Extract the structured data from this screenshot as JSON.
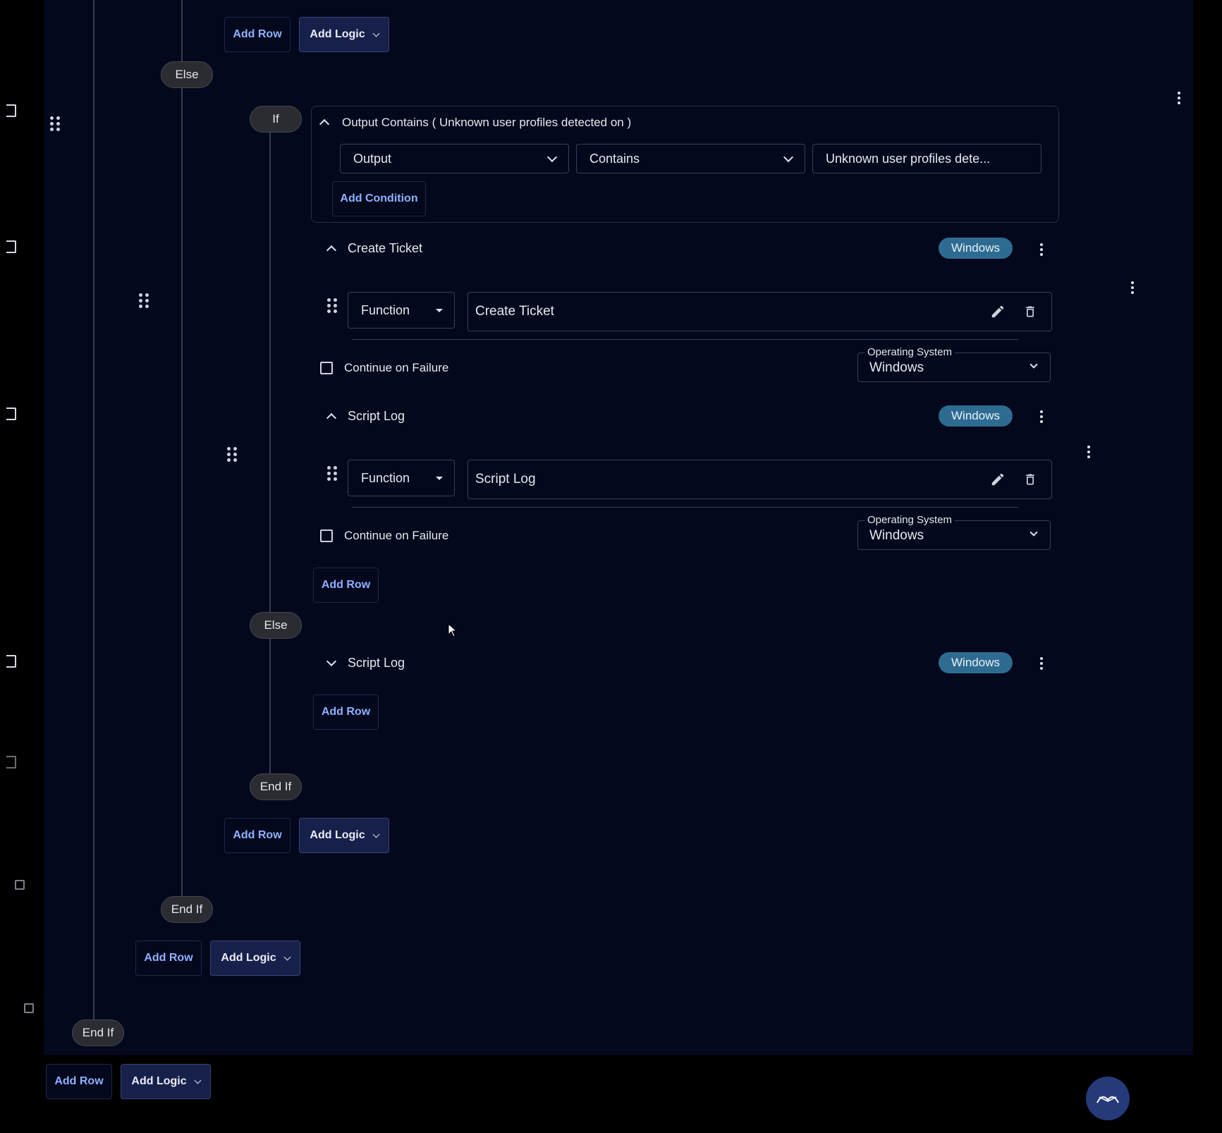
{
  "buttons": {
    "add_row": "Add Row",
    "add_logic": "Add Logic",
    "add_condition": "Add Condition"
  },
  "logic": {
    "if": "If",
    "else": "Else",
    "end_if": "End If"
  },
  "condition": {
    "title": "Output Contains ( Unknown user profiles detected on )",
    "field": "Output",
    "operator": "Contains",
    "value": "Unknown user profiles dete..."
  },
  "blocks": [
    {
      "title": "Create Ticket",
      "badge": "Windows",
      "type_select": "Function",
      "function_name": "Create Ticket",
      "continue_on_failure": "Continue on Failure",
      "os_label": "Operating System",
      "os_value": "Windows"
    },
    {
      "title": "Script Log",
      "badge": "Windows",
      "type_select": "Function",
      "function_name": "Script Log",
      "continue_on_failure": "Continue on Failure",
      "os_label": "Operating System",
      "os_value": "Windows"
    }
  ],
  "else_block": {
    "title": "Script Log",
    "badge": "Windows"
  },
  "icons": {
    "sidebar": [
      "bracket-icon",
      "bracket-icon",
      "bracket-icon",
      "bracket-icon",
      "bracket-icon",
      "square-icon",
      "square-icon"
    ],
    "fab": "chat-support-icon"
  }
}
